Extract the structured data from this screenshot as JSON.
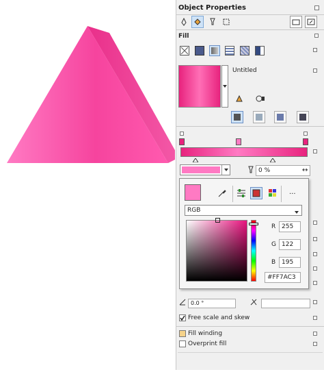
{
  "panel": {
    "title": "Object Properties",
    "fill_section_title": "Fill",
    "gradient_name": "Untitled",
    "transparency_value": "0 %",
    "angle_value": "0.0 °",
    "free_scale_label": "Free scale and skew",
    "fill_winding_label": "Fill winding",
    "overprint_label": "Overprint fill"
  },
  "color_picker": {
    "model": "RGB",
    "r_label": "R",
    "g_label": "G",
    "b_label": "B",
    "r_value": "255",
    "g_value": "122",
    "b_value": "195",
    "hex_value": "#FF7AC3",
    "more": "..."
  },
  "colors": {
    "accent": "#FF7AC3",
    "gradient_start": "#e8237e",
    "gradient_end": "#ff6fb6"
  }
}
